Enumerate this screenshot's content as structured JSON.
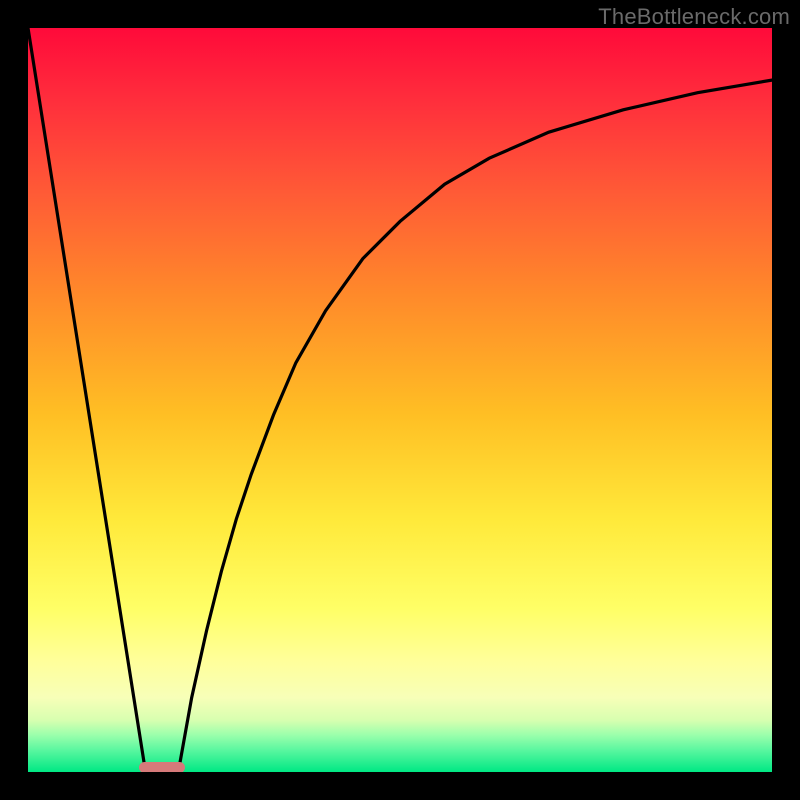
{
  "watermark": {
    "text": "TheBottleneck.com"
  },
  "chart_data": {
    "type": "line",
    "title": "",
    "xlabel": "",
    "ylabel": "",
    "xlim": [
      0,
      100
    ],
    "ylim": [
      0,
      100
    ],
    "grid": false,
    "legend": false,
    "background_gradient": {
      "direction": "vertical",
      "stops": [
        {
          "pos": 0.0,
          "color": "#ff0a3a"
        },
        {
          "pos": 0.5,
          "color": "#ffc828"
        },
        {
          "pos": 0.8,
          "color": "#ffff70"
        },
        {
          "pos": 1.0,
          "color": "#00e884"
        }
      ]
    },
    "series": [
      {
        "name": "left-falling-line",
        "x": [
          0,
          15.8
        ],
        "y": [
          100,
          0
        ]
      },
      {
        "name": "right-rising-curve",
        "x": [
          20.2,
          22,
          24,
          26,
          28,
          30,
          33,
          36,
          40,
          45,
          50,
          56,
          62,
          70,
          80,
          90,
          100
        ],
        "y": [
          0,
          10,
          19,
          27,
          34,
          40,
          48,
          55,
          62,
          69,
          74,
          79,
          82.5,
          86,
          89,
          91.3,
          93
        ]
      }
    ],
    "marker": {
      "cx_pct": 18.0,
      "cy_pct": 99.4,
      "w_pct": 6.2,
      "h_pct": 1.6,
      "color": "#d67a7a",
      "radius_px": 8
    }
  }
}
